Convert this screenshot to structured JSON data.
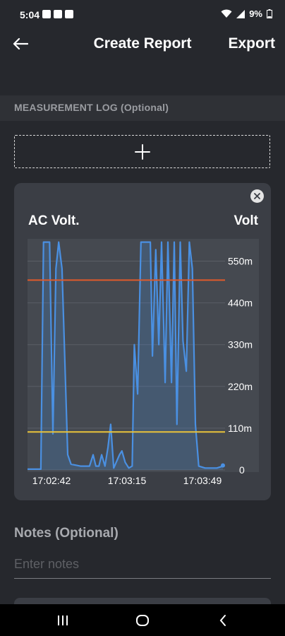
{
  "status_bar": {
    "time": "5:04",
    "battery": "9%",
    "notification_icons": [
      "app-icon",
      "app-icon",
      "image-icon"
    ],
    "right_icons": [
      "wifi-icon",
      "signal-icon",
      "battery-icon"
    ]
  },
  "app_bar": {
    "title": "Create Report",
    "export_label": "Export"
  },
  "measurement_log": {
    "header": "MEASUREMENT LOG (Optional)"
  },
  "notes": {
    "label": "Notes (Optional)",
    "placeholder": "Enter notes"
  },
  "colors": {
    "background": "#26282d",
    "card": "#3b3e45",
    "plot_area": "#454950",
    "series_line": "#4a90e2",
    "high_threshold": "#e05a2b",
    "low_threshold": "#e8c23a"
  },
  "chart_data": {
    "type": "line",
    "title": "AC Volt.",
    "unit_label": "Volt",
    "y_ticks": [
      "550m",
      "440m",
      "330m",
      "220m",
      "110m",
      "0"
    ],
    "x_ticks": [
      "17:02:42",
      "17:03:15",
      "17:03:49"
    ],
    "ylim": [
      0,
      600
    ],
    "grid": true,
    "fill_under_line": true,
    "thresholds": [
      {
        "value": 500,
        "color": "#e05a2b"
      },
      {
        "value": 100,
        "color": "#e8c23a"
      }
    ],
    "series": [
      {
        "values": [
          [
            0,
            2
          ],
          [
            4.4,
            2
          ],
          [
            5.3,
            600
          ],
          [
            7.3,
            600
          ],
          [
            8.4,
            95
          ],
          [
            9.4,
            530
          ],
          [
            10.3,
            600
          ],
          [
            11.4,
            530
          ],
          [
            12.3,
            300
          ],
          [
            13.3,
            40
          ],
          [
            14.4,
            15
          ],
          [
            17.5,
            10
          ],
          [
            20.5,
            10
          ],
          [
            21.7,
            40
          ],
          [
            22.6,
            10
          ],
          [
            23.6,
            10
          ],
          [
            24.5,
            40
          ],
          [
            25.6,
            10
          ],
          [
            26.6,
            60
          ],
          [
            27.5,
            120
          ],
          [
            28.5,
            5
          ],
          [
            30.4,
            40
          ],
          [
            31.2,
            50
          ],
          [
            32.3,
            20
          ],
          [
            33.5,
            5
          ],
          [
            34.6,
            10
          ],
          [
            35.3,
            330
          ],
          [
            36.4,
            200
          ],
          [
            37.5,
            600
          ],
          [
            40.6,
            600
          ],
          [
            41.3,
            300
          ],
          [
            42.4,
            580
          ],
          [
            43.4,
            330
          ],
          [
            44.3,
            600
          ],
          [
            45.5,
            230
          ],
          [
            46.4,
            600
          ],
          [
            47.6,
            230
          ],
          [
            48.5,
            600
          ],
          [
            49.4,
            120
          ],
          [
            50.5,
            600
          ],
          [
            51.4,
            340
          ],
          [
            52.5,
            260
          ],
          [
            53.5,
            600
          ],
          [
            54.5,
            530
          ],
          [
            55.5,
            120
          ],
          [
            56.6,
            10
          ],
          [
            58.7,
            5
          ],
          [
            62.6,
            5
          ],
          [
            64.6,
            10
          ]
        ]
      }
    ]
  }
}
